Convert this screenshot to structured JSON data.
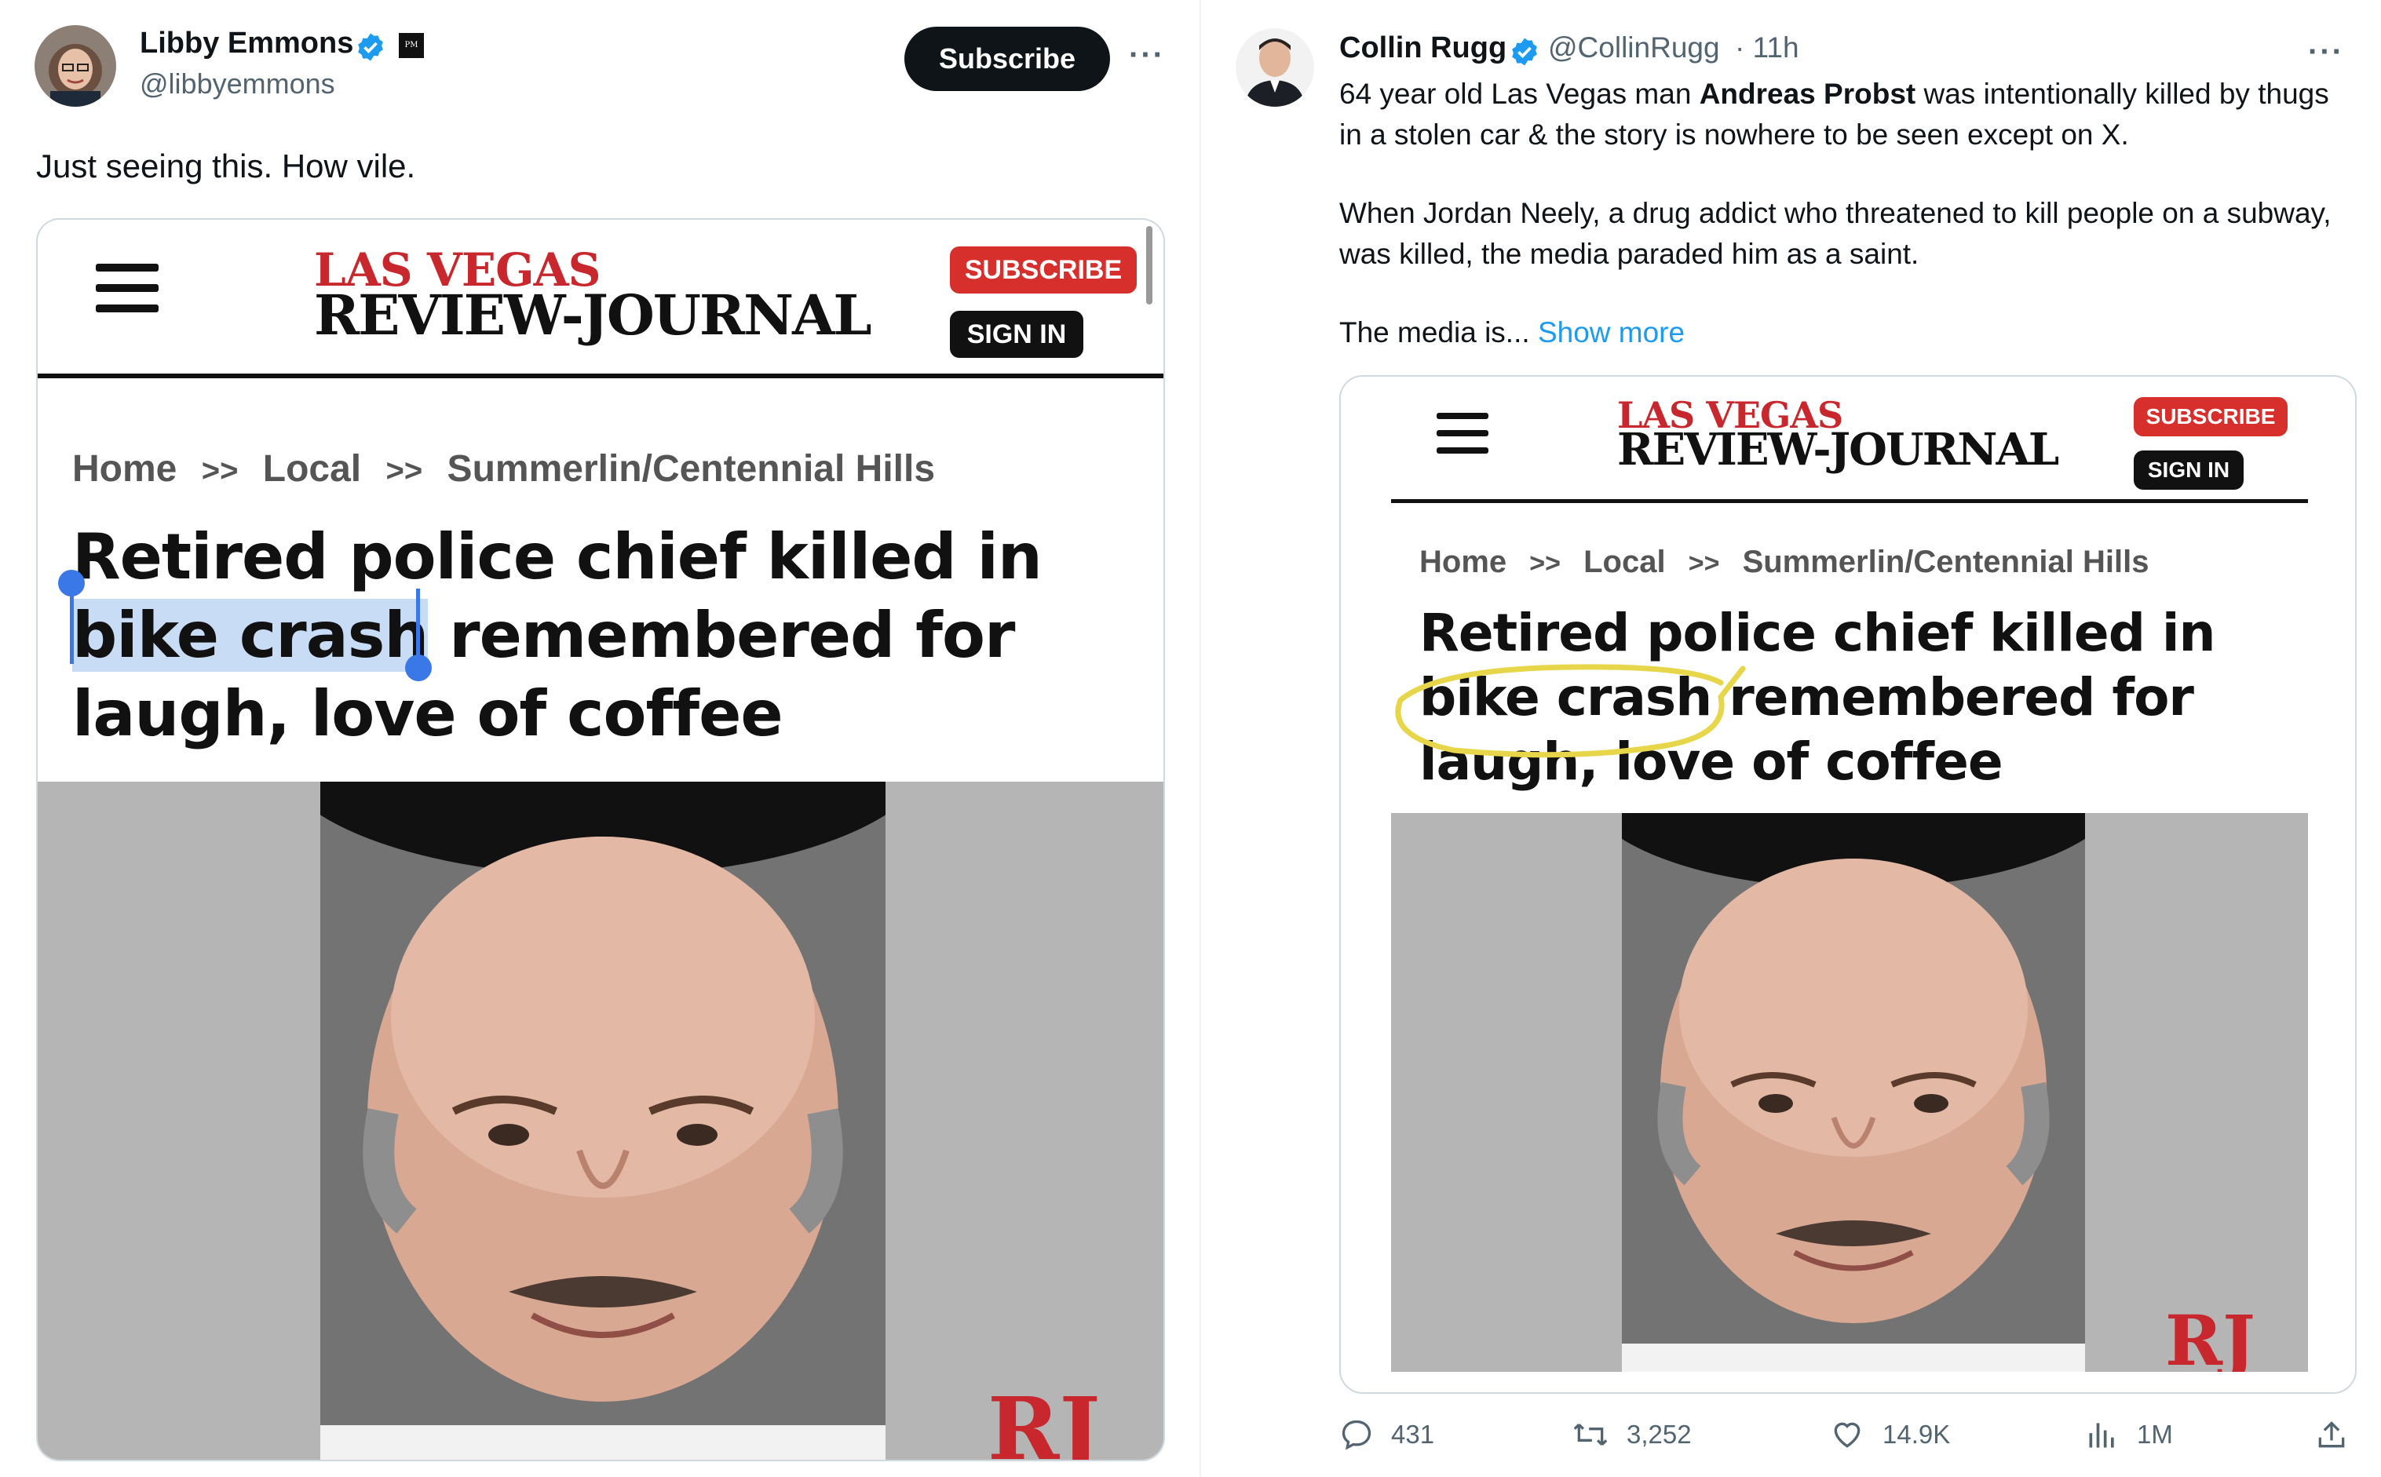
{
  "left_tweet": {
    "author_name": "Libby Emmons",
    "author_handle": "@libbyemmons",
    "affiliate_badge": "PM",
    "subscribe_label": "Subscribe",
    "more_label": "···",
    "text": "Just seeing this. How vile.",
    "card": {
      "logo_line1": "LAS VEGAS",
      "logo_line2": "REVIEW-JOURNAL",
      "subscribe_label": "SUBSCRIBE",
      "signin_label": "SIGN IN",
      "breadcrumb": [
        "Home",
        ">>",
        "Local",
        ">>",
        "Summerlin/Centennial Hills"
      ],
      "headline_line1": "Retired police chief killed in",
      "headline_selected": "bike crash",
      "headline_line2_rest": " remembered for",
      "headline_line3": "laugh, love of coffee",
      "watermark": "RJ"
    }
  },
  "right_tweet": {
    "author_name": "Collin Rugg",
    "author_handle": "@CollinRugg",
    "time": "· 11h",
    "more_label": "···",
    "text_p1_before": "64 year old Las Vegas man ",
    "text_p1_bold": "Andreas Probst",
    "text_p1_after": " was intentionally killed by thugs in a stolen car & the story is nowhere to be seen except on X.",
    "text_p2": "When Jordan Neely, a drug addict who threatened to kill people on a subway, was killed, the media paraded him as a saint.",
    "text_p3": "The media is...",
    "show_more": "Show more",
    "card": {
      "logo_line1": "LAS VEGAS",
      "logo_line2": "REVIEW-JOURNAL",
      "subscribe_label": "SUBSCRIBE",
      "signin_label": "SIGN IN",
      "breadcrumb": [
        "Home",
        ">>",
        "Local",
        ">>",
        "Summerlin/Centennial Hills"
      ],
      "headline_line1": "Retired police chief killed in",
      "headline_circled": "bike crash",
      "headline_line2_rest": " remembered for",
      "headline_line3": "laugh, love of coffee",
      "watermark": "RJ"
    },
    "actions": {
      "replies": "431",
      "reposts": "3,252",
      "likes": "14.9K",
      "views": "1M"
    }
  },
  "colors": {
    "verified_blue": "#1d9bf0",
    "rj_red": "#c8282d",
    "selection_blue": "#c9dcf5",
    "handle_gray": "#536471",
    "circle_yellow": "#e8d64a"
  },
  "icons": [
    "verified-icon",
    "hamburger-icon",
    "reply-icon",
    "repost-icon",
    "like-icon",
    "views-icon",
    "share-icon"
  ]
}
